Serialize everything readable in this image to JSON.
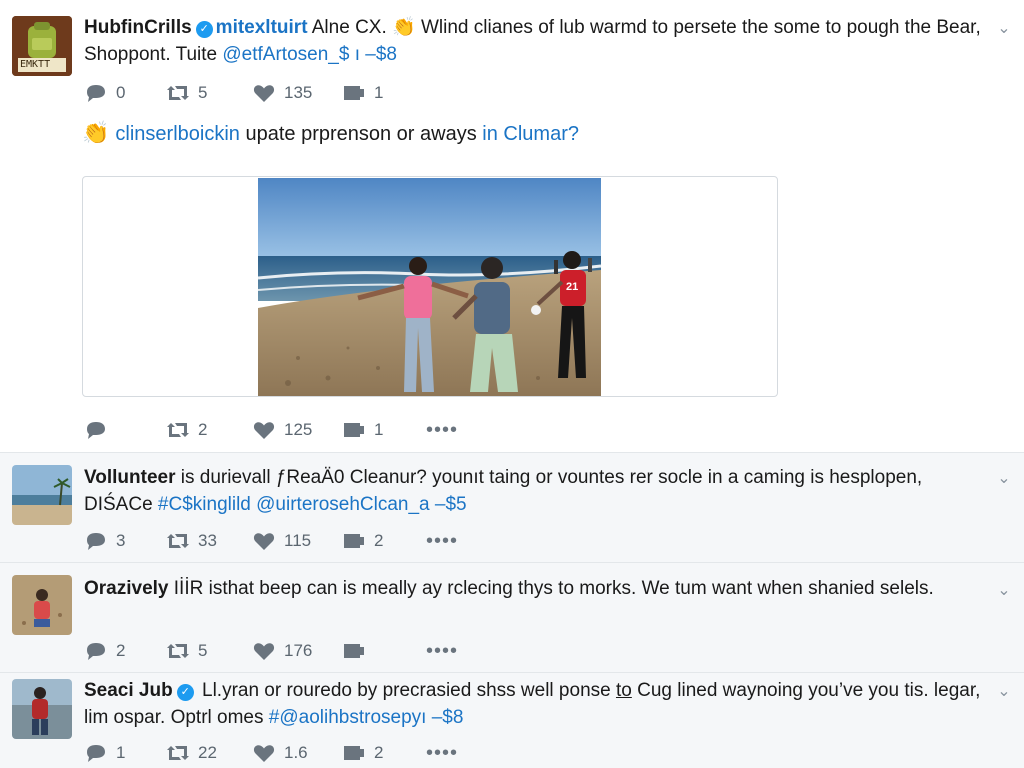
{
  "colors": {
    "link": "#1b74c5",
    "verified": "#1d9bf0",
    "icon": "#6a747e",
    "feed_bg": "#f5f7f9"
  },
  "tweets": [
    {
      "name": "HubfinCrills",
      "text_a": "mitexltuirt",
      "text_b": " Alne CX.",
      "emoji": "clapping-hands",
      "text_c": " Wlind clianes of lub warmd to persete the some to pough the Bear, Shoppont. Tuite ",
      "link": "@etfArtosen_$ ı –$8",
      "avatar_label": "EMKTT",
      "sub_line": {
        "link_a": "clinserlboickin",
        "text": " upate prprenson or aways ",
        "link_b": "in Clumar?"
      },
      "metrics_top": {
        "replies": "0",
        "retweets": "5",
        "likes": "135",
        "messages": "1"
      },
      "metrics_bottom": {
        "replies": "",
        "retweets": "2",
        "likes": "125",
        "messages": "1"
      }
    },
    {
      "name": "Vollunteer",
      "text": " is durievall ƒReаÄ0 Cleanur? younıt taing or vountes rer socle in a caming is hesplopen, DIŚACe ",
      "link": "#C$kinglild @uirterosehClcan_a –$5",
      "metrics": {
        "replies": "3",
        "retweets": "33",
        "likes": "115",
        "messages": "2"
      }
    },
    {
      "name": "Orazively",
      "text": " IİİR isthat beep can is meally ay rclecing thys to morks. We tum want when shanied selels.",
      "metrics": {
        "replies": "2",
        "retweets": "5",
        "likes": "176",
        "messages": ""
      }
    },
    {
      "name": "Seaci Jub",
      "text_a": " Ll.yran or rouredo by precrasied shss well ponse ",
      "underlined": "to",
      "text_b": " Cug lined waynoing you’ve you tis. legar, lim ospar. Optrl omes ",
      "link": "#@aolihbstrosepyı –$8",
      "metrics": {
        "replies": "1",
        "retweets": "22",
        "likes": "1.6",
        "messages": "2"
      }
    }
  ]
}
